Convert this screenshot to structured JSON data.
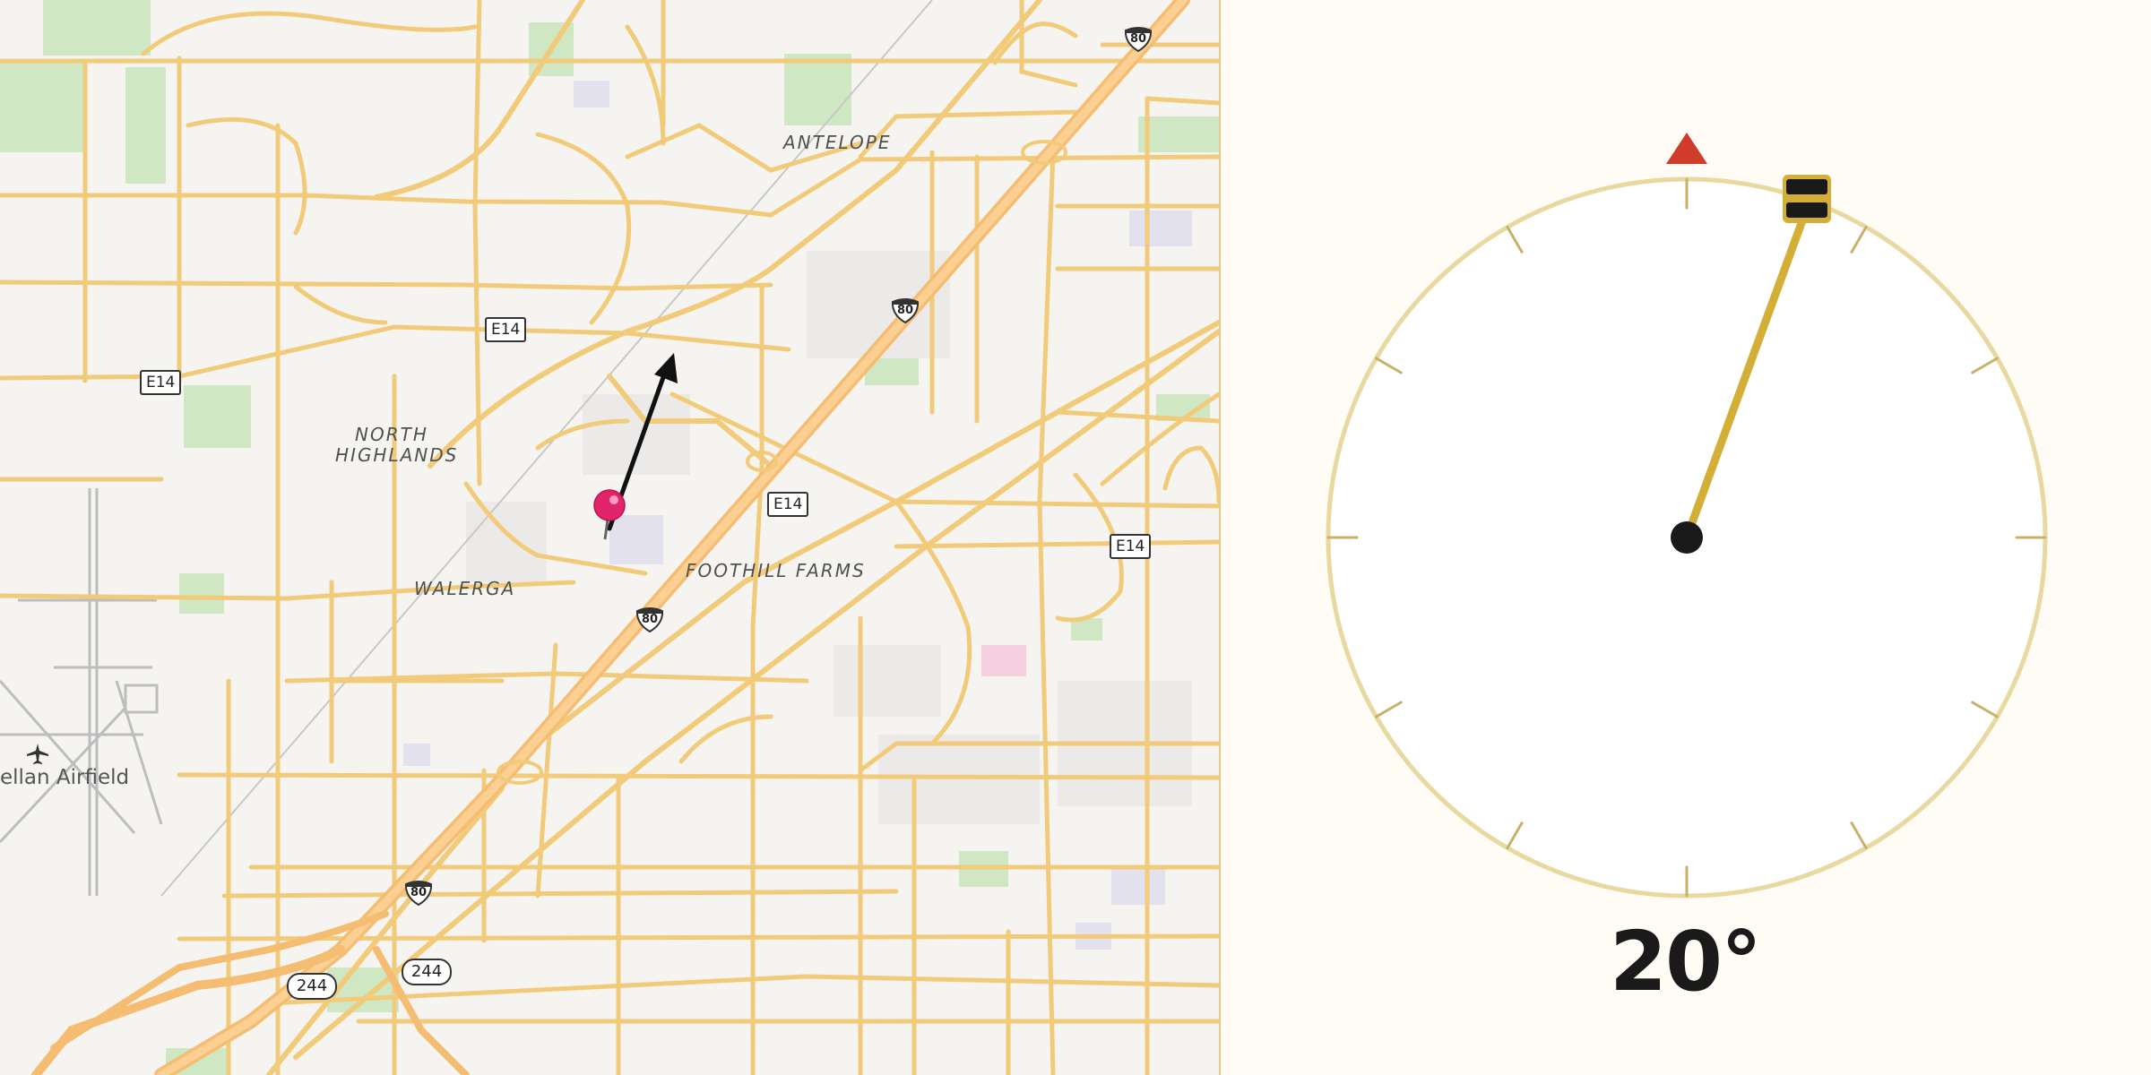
{
  "map": {
    "places": {
      "antelope": "ANTELOPE",
      "north_highlands_1": "NORTH",
      "north_highlands_2": "HIGHLANDS",
      "walerga": "WALERGA",
      "foothill_farms": "FOOTHILL FARMS",
      "airfield": "ellan Airfield"
    },
    "shields": {
      "e14": "E14",
      "i80": "80",
      "sr244": "244"
    },
    "icons": {
      "location_pin": "map-pin-icon",
      "direction_arrow": "direction-arrow-icon",
      "airport": "airplane-icon"
    }
  },
  "compass": {
    "heading_label": "20°",
    "heading_degrees": 20,
    "north_marker_color": "#d03b2c",
    "needle_color": "#d4af37",
    "ring_color": "#e8d9a0"
  }
}
